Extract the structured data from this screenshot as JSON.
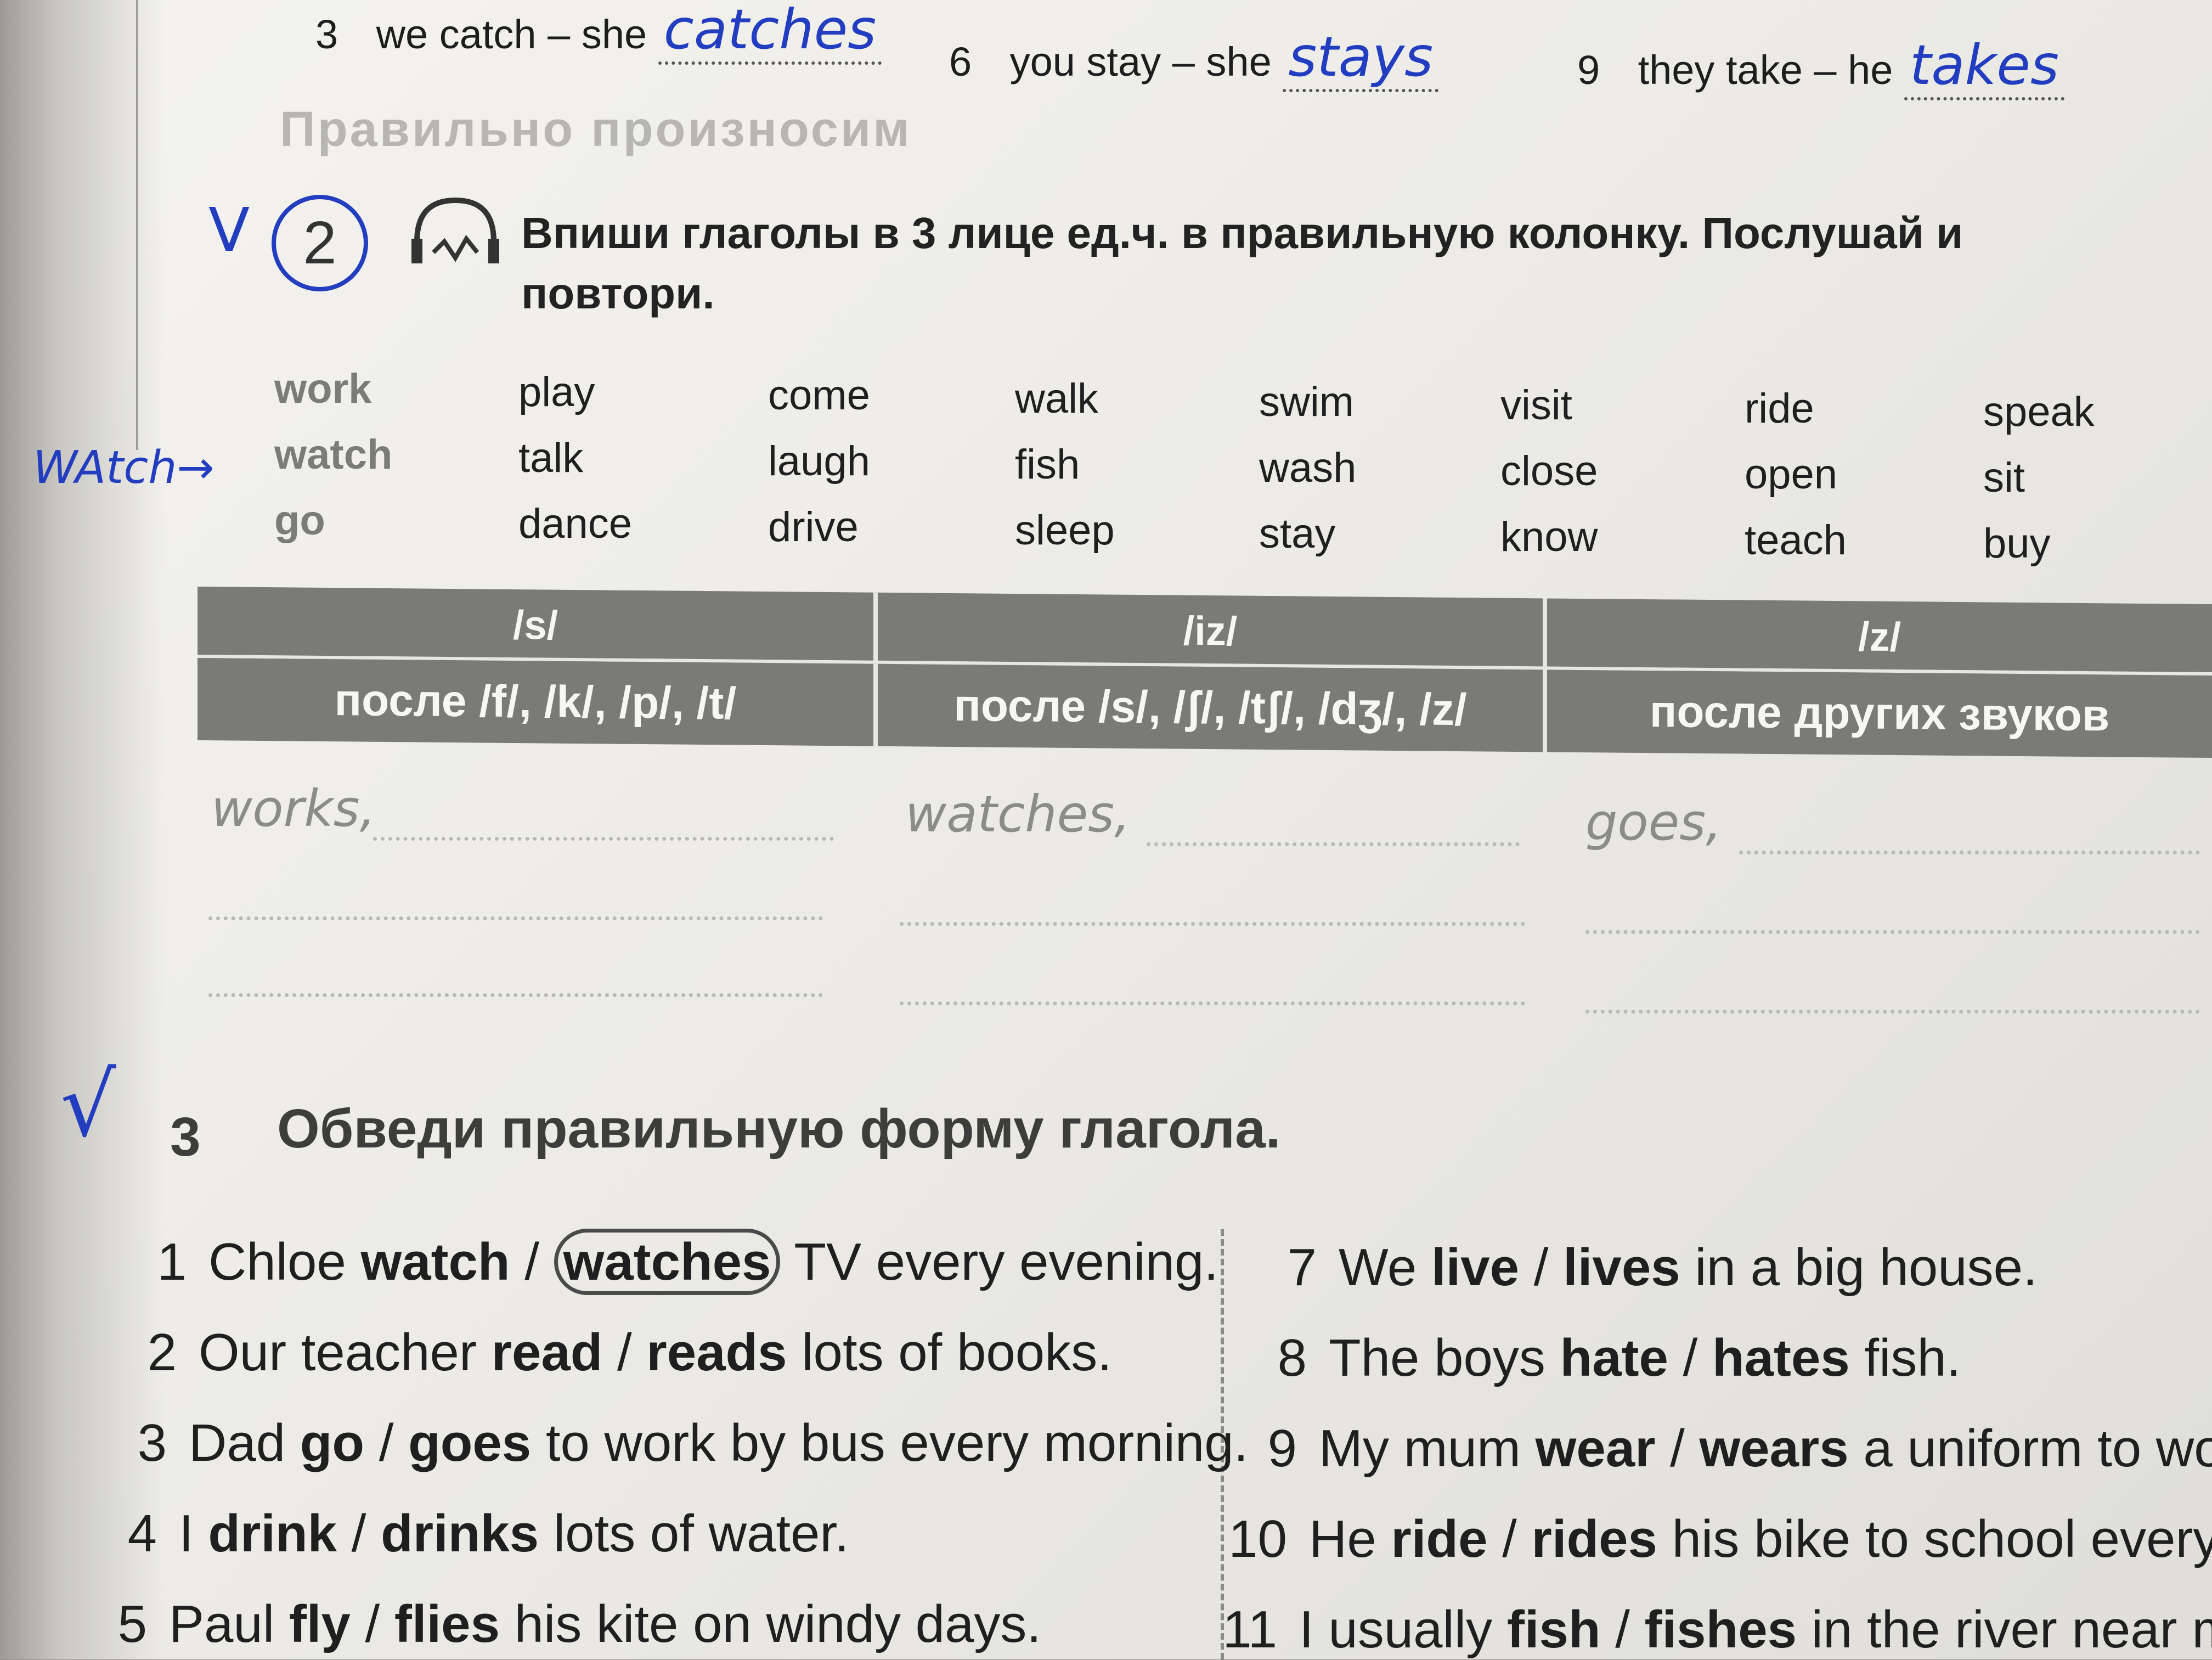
{
  "exercise1": {
    "items": [
      {
        "num": "3",
        "text": "we catch – she",
        "answer": "catches"
      },
      {
        "num": "6",
        "text": "you stay – she",
        "answer": "stays"
      },
      {
        "num": "9",
        "text": "they take – he",
        "answer": "takes"
      }
    ]
  },
  "section": {
    "title": "Правильно произносим"
  },
  "exercise2": {
    "number": "2",
    "check_mark": "V",
    "instruction": "Впиши глаголы в 3 лице ед.ч. в правильную колонку. Послушай и повтори.",
    "handwritten_note": "WAtch→",
    "words": [
      [
        "work",
        "play",
        "come",
        "walk",
        "swim",
        "visit",
        "ride",
        "speak"
      ],
      [
        "watch",
        "talk",
        "laugh",
        "fish",
        "wash",
        "close",
        "open",
        "sit"
      ],
      [
        "go",
        "dance",
        "drive",
        "sleep",
        "stay",
        "know",
        "teach",
        "buy"
      ]
    ],
    "table": {
      "headers": [
        "/s/",
        "/iz/",
        "/z/"
      ],
      "subheaders": [
        "после /f/, /k/, /p/, /t/",
        "после /s/, /ʃ/, /tʃ/, /dʒ/, /z/",
        "после других звуков"
      ],
      "answers": [
        "works,",
        "watches,",
        "goes,"
      ]
    }
  },
  "exercise3": {
    "number": "3",
    "check_mark": "√",
    "title": "Обведи правильную форму глагола.",
    "left": [
      {
        "num": "1",
        "before": "Chloe",
        "opt1": "watch",
        "sep": " / ",
        "opt2": "watches",
        "after": " TV every evening."
      },
      {
        "num": "2",
        "before": "Our teacher",
        "opt1": "read",
        "sep": " / ",
        "opt2": "reads",
        "after": " lots of books."
      },
      {
        "num": "3",
        "before": "Dad",
        "opt1": "go",
        "sep": " / ",
        "opt2": "goes",
        "after": " to work by bus every morning."
      },
      {
        "num": "4",
        "before": "I",
        "opt1": "drink",
        "sep": " / ",
        "opt2": "drinks",
        "after": " lots of water."
      },
      {
        "num": "5",
        "before": "Paul",
        "opt1": "fly",
        "sep": " / ",
        "opt2": "flies",
        "after": " his kite on windy days."
      }
    ],
    "right": [
      {
        "num": "7",
        "before": "We",
        "opt1": "live",
        "sep": " / ",
        "opt2": "lives",
        "after": " in a big house."
      },
      {
        "num": "8",
        "before": "The boys",
        "opt1": "hate",
        "sep": " / ",
        "opt2": "hates",
        "after": " fish."
      },
      {
        "num": "9",
        "before": "My mum",
        "opt1": "wear",
        "sep": " / ",
        "opt2": "wears",
        "after": " a uniform to wor"
      },
      {
        "num": "10",
        "before": "He",
        "opt1": "ride",
        "sep": " / ",
        "opt2": "rides",
        "after": " his bike to school every mo"
      },
      {
        "num": "11",
        "before": "I usually",
        "opt1": "fish",
        "sep": " / ",
        "opt2": "fishes",
        "after": " in the river near my h"
      }
    ]
  }
}
